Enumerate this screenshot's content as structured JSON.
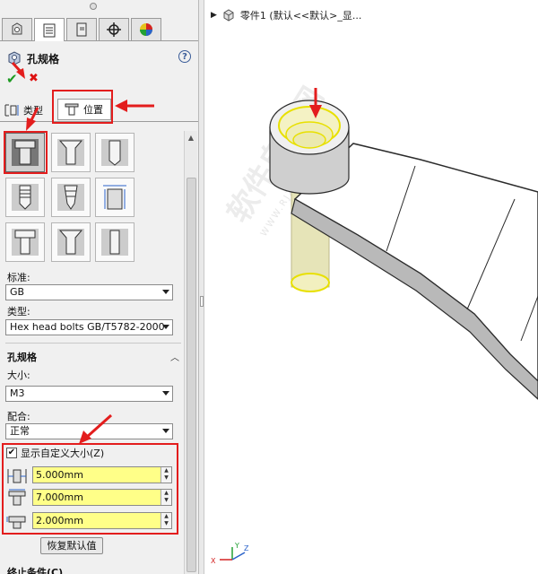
{
  "panel": {
    "title": "孔规格",
    "help": "?",
    "ok": "✔",
    "cancel": "✖",
    "tab_type": "类型",
    "tab_position": "位置"
  },
  "standard": {
    "label": "标准:",
    "value": "GB"
  },
  "type": {
    "label": "类型:",
    "value": "Hex head bolts GB/T5782-2000"
  },
  "hole_spec": {
    "title": "孔规格",
    "size_label": "大小:",
    "size_value": "M3",
    "fit_label": "配合:",
    "fit_value": "正常",
    "custom_size_label": "显示自定义大小(Z)",
    "custom_size_checked": "✔",
    "dims": [
      "5.000mm",
      "7.000mm",
      "2.000mm"
    ],
    "restore_label": "恢复默认值"
  },
  "end_condition": {
    "title": "终止条件(C)"
  },
  "graphics": {
    "tree_label": "零件1  (默认<<默认>_显...",
    "watermark": "软件自学网",
    "watermark_sub": "WWW.RJZXW.COM"
  },
  "colors": {
    "highlight": "#ffff88",
    "annotation": "#e31d1d",
    "ok": "#1d9a22"
  }
}
